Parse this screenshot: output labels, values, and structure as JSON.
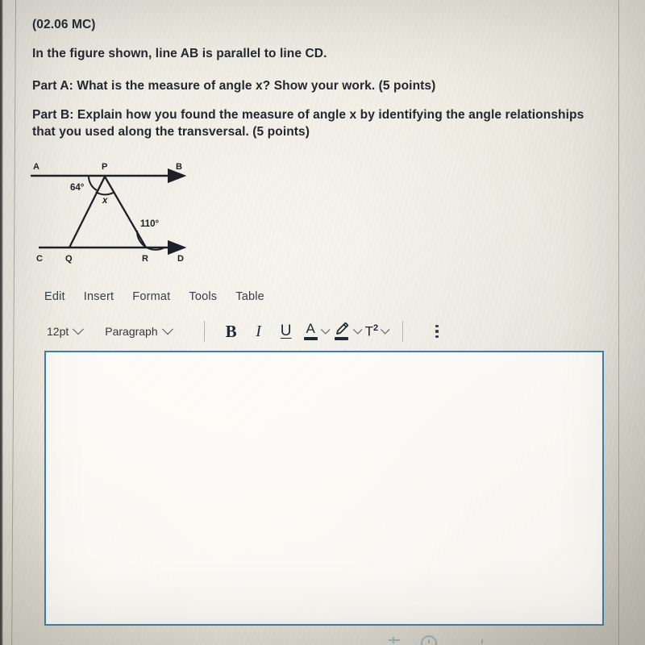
{
  "document": {
    "question_code": "(02.06 MC)",
    "intro": "In the figure shown, line AB is parallel to line CD.",
    "part_a_label": "Part A:",
    "part_a_text": " What is the measure of angle x? Show your work. (5 points)",
    "part_b_label": "Part B:",
    "part_b_text": " Explain how you found the measure of angle x by identifying the angle relationships that you used along the transversal. (5 points)"
  },
  "figure": {
    "name": "parallel-lines-transversal-diagram",
    "points": {
      "A": "A",
      "B": "B",
      "P": "P",
      "C": "C",
      "Q": "Q",
      "R": "R",
      "D": "D"
    },
    "angles": {
      "at_p_exterior": "64°",
      "at_p_interior": "x",
      "at_r": "110°"
    },
    "stroke_color": "#1d2026"
  },
  "editor": {
    "menu": [
      {
        "label": "Edit",
        "name": "menu-edit"
      },
      {
        "label": "Insert",
        "name": "menu-insert"
      },
      {
        "label": "Format",
        "name": "menu-format"
      },
      {
        "label": "Tools",
        "name": "menu-tools"
      },
      {
        "label": "Table",
        "name": "menu-table"
      }
    ],
    "toolbar": {
      "font_size": "12pt",
      "block_format": "Paragraph",
      "bold": "B",
      "italic": "I",
      "underline": "U",
      "text_color": "A",
      "highlight": "highlighter-icon",
      "superscript": "T",
      "superscript_exponent": "2",
      "more_options": "more-options-icon"
    },
    "answer_area": {
      "value": "",
      "placeholder": "",
      "border_color": "#3d7fa6"
    }
  }
}
